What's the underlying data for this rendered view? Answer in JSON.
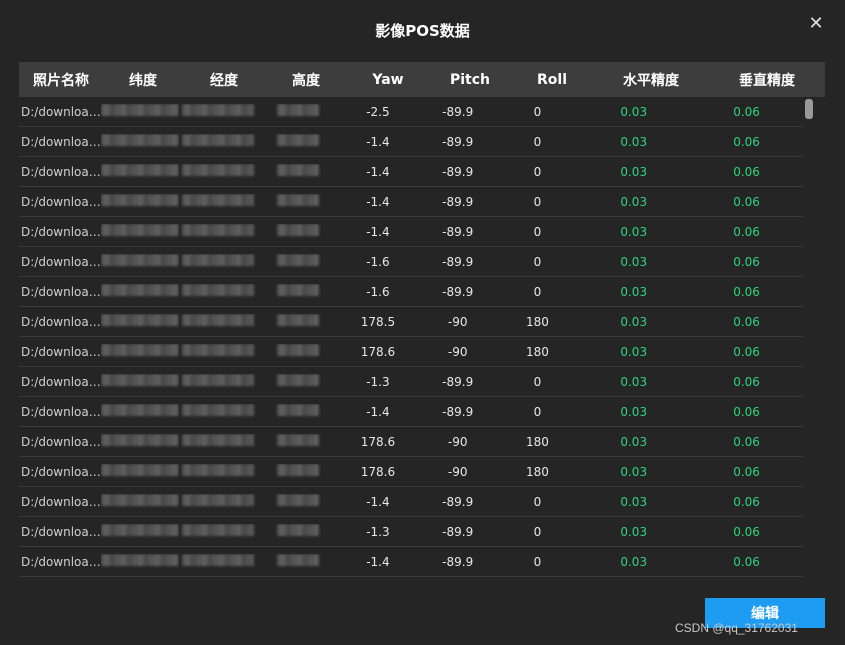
{
  "dialog": {
    "title": "影像POS数据",
    "close_glyph": "✕"
  },
  "table": {
    "headers": [
      "照片名称",
      "纬度",
      "经度",
      "高度",
      "Yaw",
      "Pitch",
      "Roll",
      "水平精度",
      "垂直精度"
    ],
    "rows": [
      {
        "name": "D:/download...",
        "yaw": "-2.5",
        "pitch": "-89.9",
        "roll": "0",
        "h_acc": "0.03",
        "v_acc": "0.06"
      },
      {
        "name": "D:/download...",
        "yaw": "-1.4",
        "pitch": "-89.9",
        "roll": "0",
        "h_acc": "0.03",
        "v_acc": "0.06"
      },
      {
        "name": "D:/download...",
        "yaw": "-1.4",
        "pitch": "-89.9",
        "roll": "0",
        "h_acc": "0.03",
        "v_acc": "0.06"
      },
      {
        "name": "D:/download...",
        "yaw": "-1.4",
        "pitch": "-89.9",
        "roll": "0",
        "h_acc": "0.03",
        "v_acc": "0.06"
      },
      {
        "name": "D:/download...",
        "yaw": "-1.4",
        "pitch": "-89.9",
        "roll": "0",
        "h_acc": "0.03",
        "v_acc": "0.06"
      },
      {
        "name": "D:/download...",
        "yaw": "-1.6",
        "pitch": "-89.9",
        "roll": "0",
        "h_acc": "0.03",
        "v_acc": "0.06"
      },
      {
        "name": "D:/download...",
        "yaw": "-1.6",
        "pitch": "-89.9",
        "roll": "0",
        "h_acc": "0.03",
        "v_acc": "0.06"
      },
      {
        "name": "D:/download...",
        "yaw": "178.5",
        "pitch": "-90",
        "roll": "180",
        "h_acc": "0.03",
        "v_acc": "0.06"
      },
      {
        "name": "D:/download...",
        "yaw": "178.6",
        "pitch": "-90",
        "roll": "180",
        "h_acc": "0.03",
        "v_acc": "0.06"
      },
      {
        "name": "D:/download...",
        "yaw": "-1.3",
        "pitch": "-89.9",
        "roll": "0",
        "h_acc": "0.03",
        "v_acc": "0.06"
      },
      {
        "name": "D:/download...",
        "yaw": "-1.4",
        "pitch": "-89.9",
        "roll": "0",
        "h_acc": "0.03",
        "v_acc": "0.06"
      },
      {
        "name": "D:/download...",
        "yaw": "178.6",
        "pitch": "-90",
        "roll": "180",
        "h_acc": "0.03",
        "v_acc": "0.06"
      },
      {
        "name": "D:/download...",
        "yaw": "178.6",
        "pitch": "-90",
        "roll": "180",
        "h_acc": "0.03",
        "v_acc": "0.06"
      },
      {
        "name": "D:/download...",
        "yaw": "-1.4",
        "pitch": "-89.9",
        "roll": "0",
        "h_acc": "0.03",
        "v_acc": "0.06"
      },
      {
        "name": "D:/download...",
        "yaw": "-1.3",
        "pitch": "-89.9",
        "roll": "0",
        "h_acc": "0.03",
        "v_acc": "0.06"
      },
      {
        "name": "D:/download...",
        "yaw": "-1.4",
        "pitch": "-89.9",
        "roll": "0",
        "h_acc": "0.03",
        "v_acc": "0.06"
      }
    ]
  },
  "footer": {
    "edit_label": "编辑",
    "watermark": "CSDN @qq_31762031"
  },
  "colors": {
    "accent": "#1e9cf2",
    "precision_green": "#2fd47a",
    "header_bg": "#3d3d3d",
    "dialog_bg": "#252525"
  }
}
